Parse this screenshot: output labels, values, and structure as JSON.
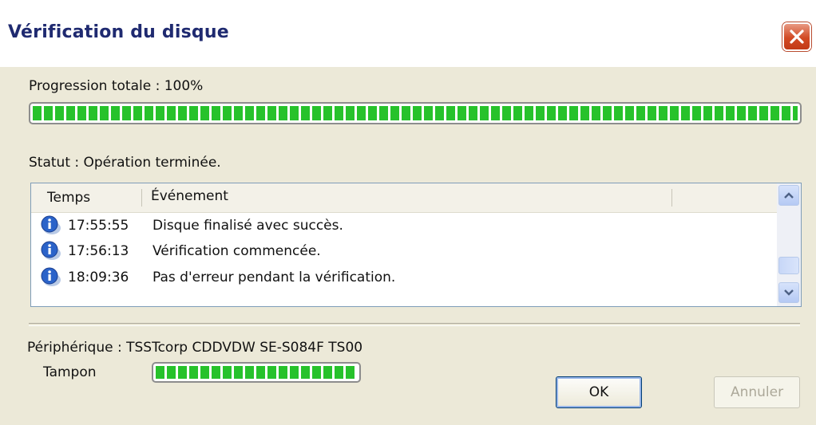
{
  "window": {
    "title": "Vérification du disque"
  },
  "progress_total": {
    "label": "Progression totale : 100%",
    "value_percent": 100
  },
  "status": {
    "label": "Statut : Opération terminée."
  },
  "event_list": {
    "columns": [
      "Temps",
      "Événement"
    ],
    "rows": [
      {
        "time": "17:55:55",
        "event": "Disque finalisé avec succès.",
        "icon": "info-icon"
      },
      {
        "time": "17:56:13",
        "event": "Vérification commencée.",
        "icon": "info-icon"
      },
      {
        "time": "18:09:36",
        "event": "Pas d'erreur pendant la vérification.",
        "icon": "info-icon"
      }
    ]
  },
  "device": {
    "label": "Périphérique : TSSTcorp CDDVDW SE-S084F TS00"
  },
  "buffer": {
    "label": "Tampon",
    "value_percent": 100
  },
  "buttons": {
    "ok": "OK",
    "cancel": "Annuler"
  },
  "colors": {
    "progress_green": "#27c22b",
    "title_text": "#1f2a70",
    "close_red": "#d24a24"
  }
}
